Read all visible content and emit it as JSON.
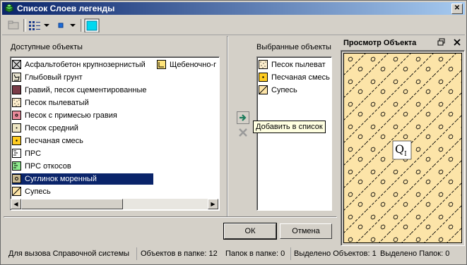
{
  "window": {
    "title": "Список Слоев легенды",
    "close_glyph": "✕"
  },
  "available": {
    "header": "Доступные объекты",
    "items": [
      {
        "label": "Асфальтобетон крупнозернистый",
        "icon": "grid-x-icon"
      },
      {
        "label": "Глыбовый грунт",
        "icon": "boulder-icon"
      },
      {
        "label": "Гравий, песок сцементированные",
        "icon": "maroon-fill-icon"
      },
      {
        "label": "Песок пылеватый",
        "icon": "dotted-sand-icon"
      },
      {
        "label": "Песок с примесью гравия",
        "icon": "pink-gravel-icon"
      },
      {
        "label": "Песок средний",
        "icon": "sand-dot-icon"
      },
      {
        "label": "Песчаная смесь",
        "icon": "yellow-dot-icon"
      },
      {
        "label": "ПРС",
        "icon": "prs-icon"
      },
      {
        "label": "ПРС откосов",
        "icon": "green-prs-icon"
      },
      {
        "label": "Суглинок моренный",
        "icon": "moraine-loam-icon",
        "selected": true
      },
      {
        "label": "Супесь",
        "icon": "sandy-loam-icon"
      }
    ],
    "second_column": {
      "label": "Щебеночно-г",
      "icon": "gravel-yellow-icon"
    }
  },
  "selected": {
    "header": "Выбранные объекты",
    "items": [
      {
        "label": "Песок пылеват",
        "icon": "dotted-sand-icon"
      },
      {
        "label": "Песчаная смесь",
        "icon": "yellow-dot-icon"
      },
      {
        "label": "Супесь",
        "icon": "sandy-loam-icon"
      }
    ]
  },
  "tooltip": "Добавить в список",
  "preview": {
    "title": "Просмотр Объекта",
    "symbol": "Q",
    "symbol_sub": "I"
  },
  "buttons": {
    "ok": "ОК",
    "cancel": "Отмена"
  },
  "status": {
    "help": "Для вызова Справочной системы",
    "objects_in_folder": "Объектов в папке: 12",
    "folders_in_folder": "Папок в папке: 0",
    "selected_objects": "Выделено Объектов: 1",
    "selected_folders": "Выделено Папок: 0"
  },
  "colors": {
    "accent": "#0a246a",
    "selection": "#0a246a",
    "preview_fill": "#fce4a8",
    "window": "#d4d0c8"
  }
}
